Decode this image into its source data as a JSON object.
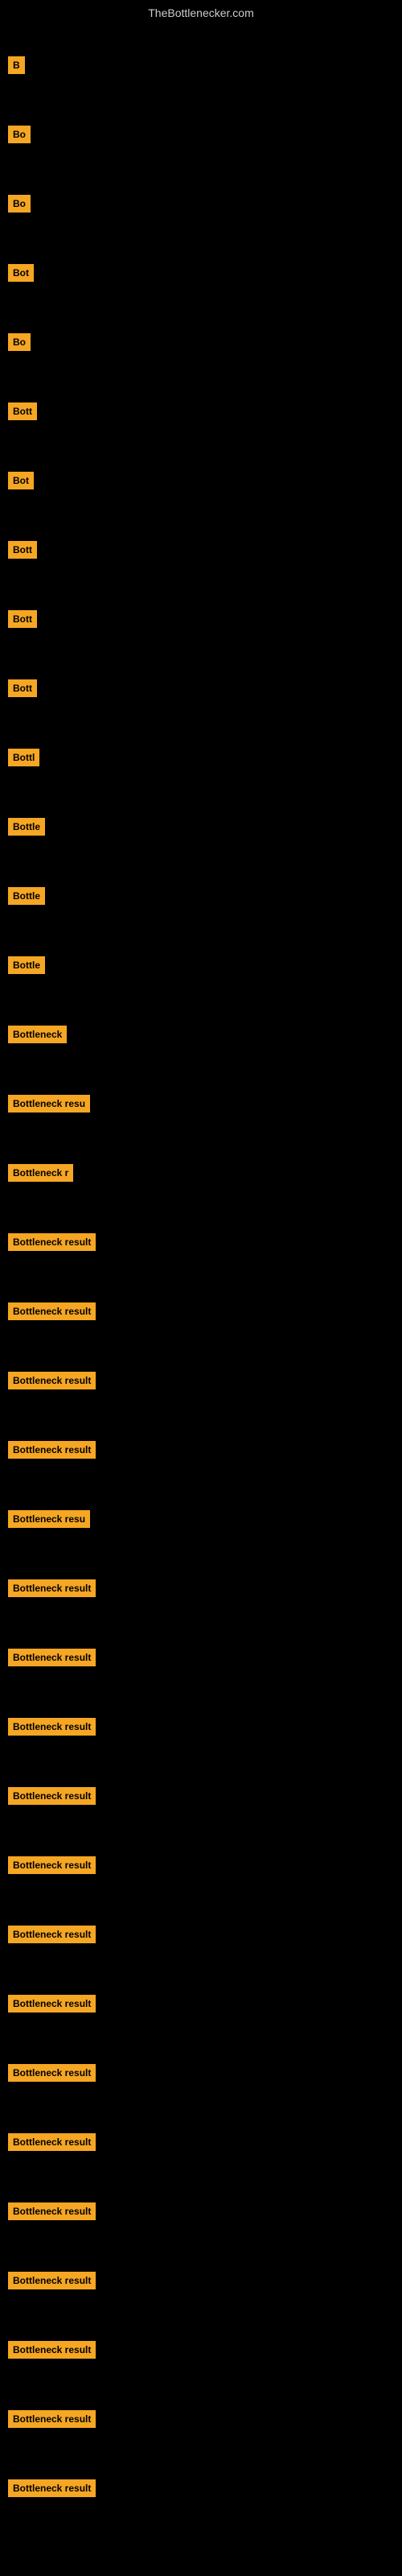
{
  "site": {
    "title": "TheBottlenecker.com"
  },
  "items": [
    {
      "id": 1,
      "label": "B"
    },
    {
      "id": 2,
      "label": "Bo"
    },
    {
      "id": 3,
      "label": "Bo"
    },
    {
      "id": 4,
      "label": "Bot"
    },
    {
      "id": 5,
      "label": "Bo"
    },
    {
      "id": 6,
      "label": "Bott"
    },
    {
      "id": 7,
      "label": "Bot"
    },
    {
      "id": 8,
      "label": "Bott"
    },
    {
      "id": 9,
      "label": "Bott"
    },
    {
      "id": 10,
      "label": "Bott"
    },
    {
      "id": 11,
      "label": "Bottl"
    },
    {
      "id": 12,
      "label": "Bottle"
    },
    {
      "id": 13,
      "label": "Bottle"
    },
    {
      "id": 14,
      "label": "Bottle"
    },
    {
      "id": 15,
      "label": "Bottleneck"
    },
    {
      "id": 16,
      "label": "Bottleneck resu"
    },
    {
      "id": 17,
      "label": "Bottleneck r"
    },
    {
      "id": 18,
      "label": "Bottleneck result"
    },
    {
      "id": 19,
      "label": "Bottleneck result"
    },
    {
      "id": 20,
      "label": "Bottleneck result"
    },
    {
      "id": 21,
      "label": "Bottleneck result"
    },
    {
      "id": 22,
      "label": "Bottleneck resu"
    },
    {
      "id": 23,
      "label": "Bottleneck result"
    },
    {
      "id": 24,
      "label": "Bottleneck result"
    },
    {
      "id": 25,
      "label": "Bottleneck result"
    },
    {
      "id": 26,
      "label": "Bottleneck result"
    },
    {
      "id": 27,
      "label": "Bottleneck result"
    },
    {
      "id": 28,
      "label": "Bottleneck result"
    },
    {
      "id": 29,
      "label": "Bottleneck result"
    },
    {
      "id": 30,
      "label": "Bottleneck result"
    },
    {
      "id": 31,
      "label": "Bottleneck result"
    },
    {
      "id": 32,
      "label": "Bottleneck result"
    },
    {
      "id": 33,
      "label": "Bottleneck result"
    },
    {
      "id": 34,
      "label": "Bottleneck result"
    },
    {
      "id": 35,
      "label": "Bottleneck result"
    },
    {
      "id": 36,
      "label": "Bottleneck result"
    }
  ]
}
